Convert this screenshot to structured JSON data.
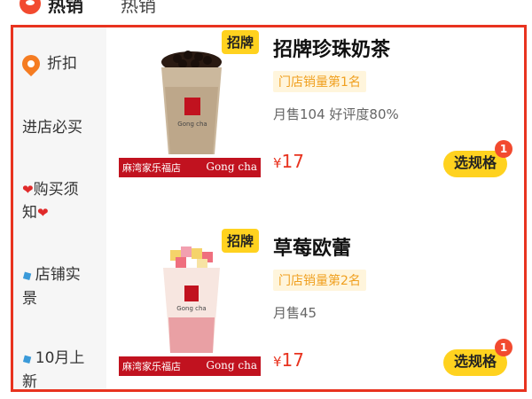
{
  "top_tabs": [
    "热销",
    "热销"
  ],
  "sidebar": {
    "items": [
      {
        "label": "折扣",
        "icon": "location-pin-icon"
      },
      {
        "label": "进店必买"
      },
      {
        "label": "购买须知",
        "icon": "heart-icon"
      },
      {
        "label": "店铺实景",
        "icon": "candy-icon"
      },
      {
        "label": "10月上新",
        "icon": "candy-icon"
      }
    ]
  },
  "products": [
    {
      "tag": "招牌",
      "name": "招牌珍珠奶茶",
      "rank": "门店销量第1名",
      "sales": "月售104  好评度80%",
      "price_symbol": "¥",
      "price": "17",
      "spec_button": "选规格",
      "badge_count": "1",
      "image_caption": "麻湾家乐福店",
      "image_brand": "Gong cha"
    },
    {
      "tag": "招牌",
      "name": "草莓欧蕾",
      "rank": "门店销量第2名",
      "sales": "月售45",
      "price_symbol": "¥",
      "price": "17",
      "spec_button": "选规格",
      "badge_count": "1",
      "image_caption": "麻湾家乐福店",
      "image_brand": "Gong cha"
    }
  ],
  "colors": {
    "accent_red": "#e8331f",
    "tag_yellow": "#ffd21f",
    "rank_text": "#f0a020"
  }
}
